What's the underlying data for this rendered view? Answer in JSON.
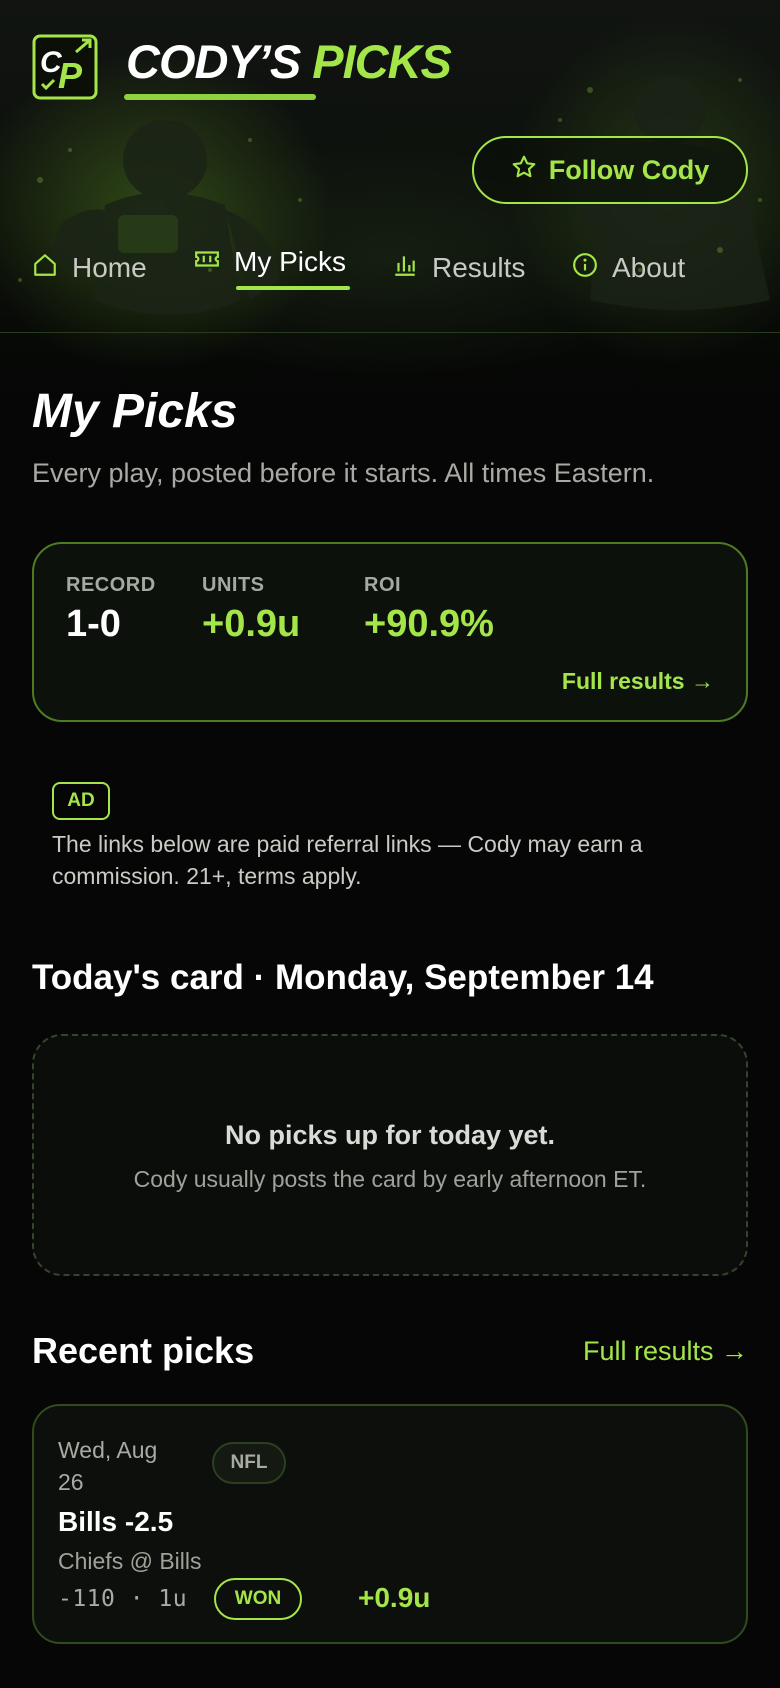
{
  "brand": {
    "name_white": "CODY’S",
    "name_green": "PICKS",
    "logo_letters": "CP"
  },
  "header": {
    "follow_label": "Follow Cody"
  },
  "nav": {
    "items": [
      {
        "label": "Home",
        "icon": "home-icon"
      },
      {
        "label": "My Picks",
        "icon": "ticket-icon",
        "active": true
      },
      {
        "label": "Results",
        "icon": "bar-chart-icon"
      },
      {
        "label": "About",
        "icon": "info-icon"
      }
    ]
  },
  "page": {
    "title": "My Picks",
    "subtitle": "Every play, posted before it starts. All times Eastern."
  },
  "stats": {
    "record_label": "RECORD",
    "record_value": "1-0",
    "units_label": "UNITS",
    "units_value": "+0.9u",
    "roi_label": "ROI",
    "roi_value": "+90.9%",
    "full_results": "Full results →"
  },
  "ad": {
    "badge": "AD",
    "text": "The links below are paid referral links — Cody may earn a commission. 21+, terms apply."
  },
  "today": {
    "title": "Today's card · Monday, September 14",
    "empty_title": "No picks up for today yet.",
    "empty_sub": "Cody usually posts the card by early afternoon ET."
  },
  "recent": {
    "title": "Recent picks",
    "link": "Full results →",
    "picks": [
      {
        "date": "Wed, Aug 26",
        "league": "NFL",
        "pick": "Bills -2.5",
        "matchup": "Chiefs @ Bills",
        "odds": "-110 · 1u",
        "status": "WON",
        "result": "+0.9u"
      }
    ]
  },
  "colors": {
    "accent": "#a4e64a",
    "background": "#050605",
    "card": "#0d110c",
    "border": "#4f7a24"
  }
}
